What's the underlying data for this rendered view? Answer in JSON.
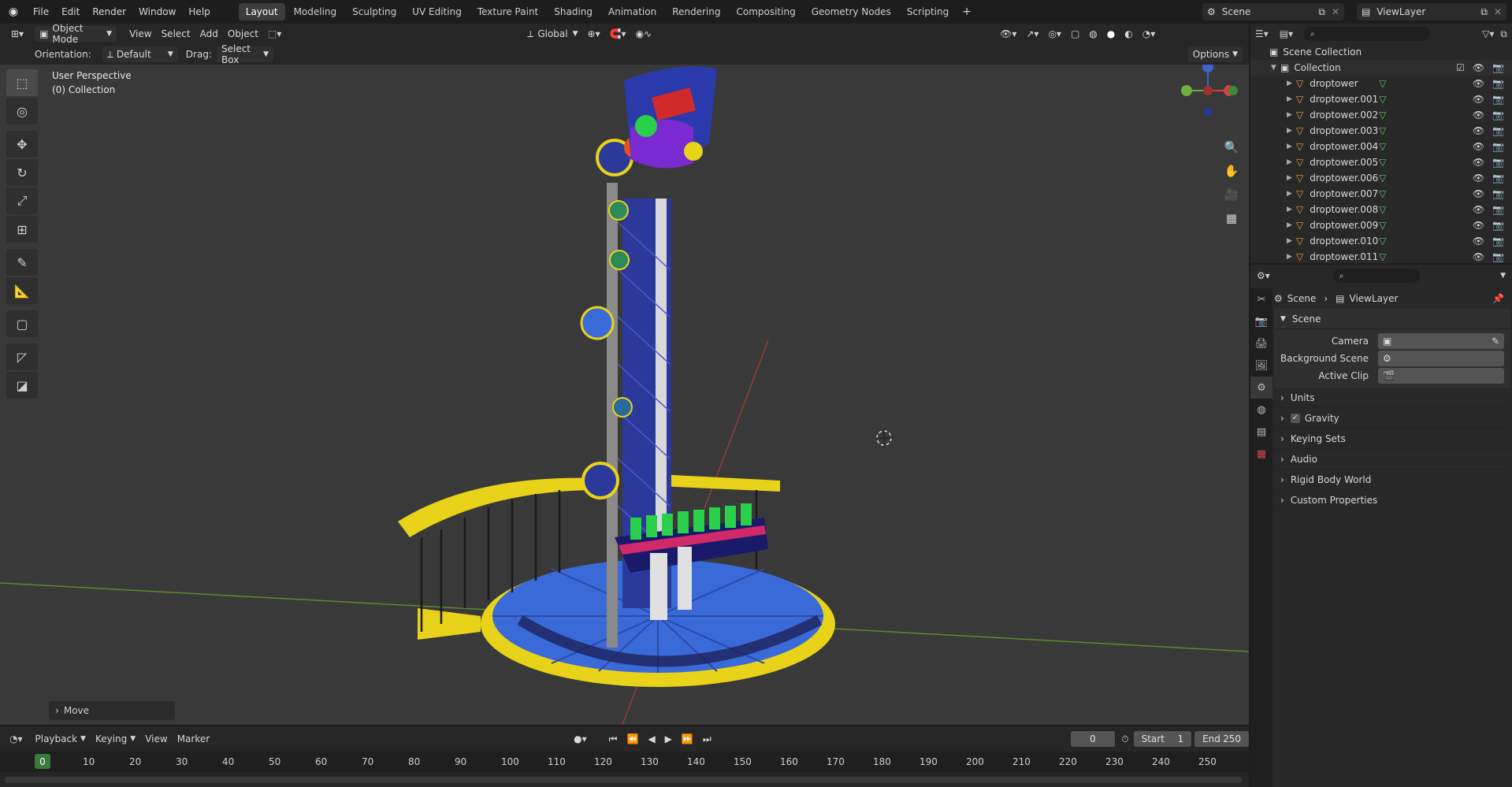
{
  "menu": {
    "file": "File",
    "edit": "Edit",
    "render": "Render",
    "window": "Window",
    "help": "Help"
  },
  "workspaces": [
    "Layout",
    "Modeling",
    "Sculpting",
    "UV Editing",
    "Texture Paint",
    "Shading",
    "Animation",
    "Rendering",
    "Compositing",
    "Geometry Nodes",
    "Scripting"
  ],
  "scene_name": "Scene",
  "view_layer": "ViewLayer",
  "viewport_header": {
    "mode": "Object Mode",
    "view": "View",
    "select": "Select",
    "add": "Add",
    "object": "Object",
    "transform": "Global"
  },
  "tool_header": {
    "orientation_label": "Orientation:",
    "orientation_value": "Default",
    "drag_label": "Drag:",
    "drag_value": "Select Box",
    "options": "Options"
  },
  "viewport": {
    "perspective": "User Perspective",
    "collection": "(0) Collection",
    "last_op": "Move"
  },
  "outliner": {
    "scene_collection": "Scene Collection",
    "collection": "Collection",
    "objects": [
      "droptower",
      "droptower.001",
      "droptower.002",
      "droptower.003",
      "droptower.004",
      "droptower.005",
      "droptower.006",
      "droptower.007",
      "droptower.008",
      "droptower.009",
      "droptower.010",
      "droptower.011"
    ]
  },
  "properties": {
    "breadcrumb_scene": "Scene",
    "breadcrumb_layer": "ViewLayer",
    "panel_title": "Scene",
    "camera_label": "Camera",
    "bg_scene_label": "Background Scene",
    "active_clip_label": "Active Clip",
    "sections": [
      "Units",
      "Gravity",
      "Keying Sets",
      "Audio",
      "Rigid Body World",
      "Custom Properties"
    ]
  },
  "timeline": {
    "playback": "Playback",
    "keying": "Keying",
    "view": "View",
    "marker": "Marker",
    "current_frame": "0",
    "start_label": "Start",
    "start": "1",
    "end_label": "End",
    "end": "250",
    "ticks": [
      "0",
      "10",
      "20",
      "30",
      "40",
      "50",
      "60",
      "70",
      "80",
      "90",
      "100",
      "110",
      "120",
      "130",
      "140",
      "150",
      "160",
      "170",
      "180",
      "190",
      "200",
      "210",
      "220",
      "230",
      "240",
      "250"
    ]
  },
  "colors": {
    "accent": "#4772b3",
    "active_frame": "#3b7a3b",
    "x_axis": "#a83a3a",
    "y_axis": "#5e8a2a",
    "tower_blue": "#2b3a9a",
    "platform_yellow": "#e8d21a",
    "platform_blue": "#3a6ad8"
  }
}
